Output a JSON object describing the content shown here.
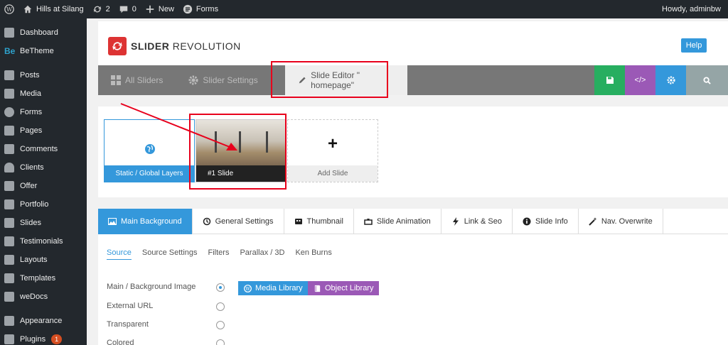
{
  "adminbar": {
    "site_name": "Hills at Silang",
    "updates_count": "2",
    "comments_count": "0",
    "new_label": "New",
    "forms_label": "Forms",
    "howdy": "Howdy, adminbw"
  },
  "sidebar": {
    "items": [
      {
        "label": "Dashboard"
      },
      {
        "label": "BeTheme"
      },
      {
        "label": "Posts"
      },
      {
        "label": "Media"
      },
      {
        "label": "Forms"
      },
      {
        "label": "Pages"
      },
      {
        "label": "Comments"
      },
      {
        "label": "Clients"
      },
      {
        "label": "Offer"
      },
      {
        "label": "Portfolio"
      },
      {
        "label": "Slides"
      },
      {
        "label": "Testimonials"
      },
      {
        "label": "Layouts"
      },
      {
        "label": "Templates"
      },
      {
        "label": "weDocs"
      },
      {
        "label": "Appearance"
      },
      {
        "label": "Plugins",
        "badge": "1"
      }
    ]
  },
  "header": {
    "logo_bold": "SLIDER",
    "logo_rest": "REVOLUTION",
    "help_label": "Help"
  },
  "toolbar": {
    "all_sliders": "All Sliders",
    "slider_settings": "Slider Settings",
    "slide_editor": "Slide Editor \" homepage\"",
    "code_label": "</>"
  },
  "slides": {
    "static_label": "Static / Global Layers",
    "slide1_label": "#1 Slide",
    "add_label": "Add Slide",
    "plus": "+"
  },
  "tabs": [
    {
      "label": "Main Background"
    },
    {
      "label": "General Settings"
    },
    {
      "label": "Thumbnail"
    },
    {
      "label": "Slide Animation"
    },
    {
      "label": "Link & Seo"
    },
    {
      "label": "Slide Info"
    },
    {
      "label": "Nav. Overwrite"
    }
  ],
  "subtabs": [
    "Source",
    "Source Settings",
    "Filters",
    "Parallax / 3D",
    "Ken Burns"
  ],
  "source_options": [
    "Main / Background Image",
    "External URL",
    "Transparent",
    "Colored"
  ],
  "buttons": {
    "media_library": "Media Library",
    "object_library": "Object Library"
  },
  "colors": {
    "accent": "#3498db",
    "save": "#27ae60",
    "code": "#9b59b6",
    "settings": "#3498db",
    "search": "#95a5a6",
    "annotation": "#e8001c"
  }
}
